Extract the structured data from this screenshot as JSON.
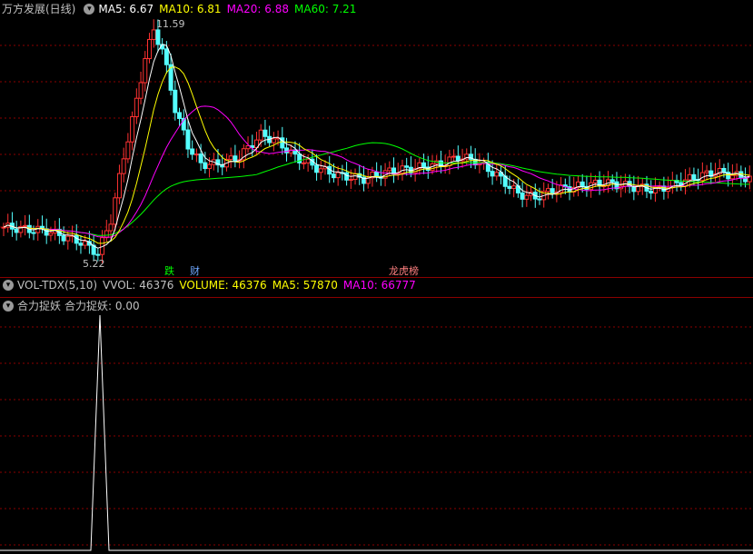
{
  "main_panel": {
    "title": "万方发展(日线)",
    "ma5": "MA5: 6.67",
    "ma10": "MA10: 6.81",
    "ma20": "MA20: 6.88",
    "ma60": "MA60: 7.21",
    "high_label": "11.59",
    "low_label": "5.22",
    "tag_die": "跌",
    "tag_cai": "财",
    "tag_bang": "龙虎榜"
  },
  "vol_panel": {
    "title": "VOL-TDX(5,10)",
    "vvol": "VVOL: 46376",
    "volume": "VOLUME: 46376",
    "ma5": "MA5: 57870",
    "ma10": "MA10: 66777"
  },
  "indicator_panel": {
    "title": "合力捉妖",
    "value": "合力捉妖: 0.00"
  },
  "colors": {
    "up": "#ff3232",
    "down": "#54ffff",
    "ma5": "#ffffff",
    "ma10": "#ffff00",
    "ma20": "#ff00ff",
    "ma60": "#00ff00",
    "grid": "#8b0000"
  },
  "chart_data": {
    "type": "candlestick",
    "price_labels": {
      "high": 11.59,
      "low": 5.22
    },
    "indicator_peak": 1
  }
}
